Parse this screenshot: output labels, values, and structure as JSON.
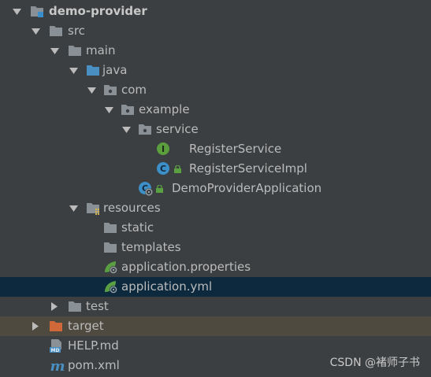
{
  "tree": [
    {
      "label": "demo-provider",
      "expanded": true,
      "icon": "module-folder-icon",
      "bold": true
    },
    {
      "label": "src",
      "expanded": true,
      "icon": "folder-icon"
    },
    {
      "label": "main",
      "expanded": true,
      "icon": "folder-icon"
    },
    {
      "label": "java",
      "expanded": true,
      "icon": "source-root-folder-icon"
    },
    {
      "label": "com",
      "expanded": true,
      "icon": "package-icon"
    },
    {
      "label": "example",
      "expanded": true,
      "icon": "package-icon"
    },
    {
      "label": "service",
      "expanded": true,
      "icon": "package-icon"
    },
    {
      "label": "RegisterService",
      "icon": "interface-icon"
    },
    {
      "label": "RegisterServiceImpl",
      "icon": "class-icon"
    },
    {
      "label": "DemoProviderApplication",
      "icon": "spring-boot-class-icon"
    },
    {
      "label": "resources",
      "expanded": true,
      "icon": "resources-folder-icon"
    },
    {
      "label": "static",
      "icon": "folder-icon"
    },
    {
      "label": "templates",
      "icon": "folder-icon"
    },
    {
      "label": "application.properties",
      "icon": "spring-config-icon"
    },
    {
      "label": "application.yml",
      "icon": "spring-config-icon",
      "selected": true
    },
    {
      "label": "test",
      "expanded": false,
      "icon": "folder-icon"
    },
    {
      "label": "target",
      "expanded": false,
      "icon": "excluded-folder-icon",
      "excluded": true
    },
    {
      "label": "HELP.md",
      "icon": "markdown-file-icon"
    },
    {
      "label": "pom.xml",
      "icon": "maven-pom-icon"
    }
  ],
  "watermark": "CSDN @褚师子书",
  "colors": {
    "background": "#3c3f41",
    "selection": "#0d293e",
    "excluded_row": "#4e4a3f",
    "text": "#bbbbbb",
    "folder": "#8a9196",
    "source_folder": "#4a8fc2",
    "excluded_folder": "#d0683a",
    "interface_badge": "#5b9e3d",
    "class_badge": "#3d8fc8",
    "spring_leaf": "#5aa042"
  }
}
